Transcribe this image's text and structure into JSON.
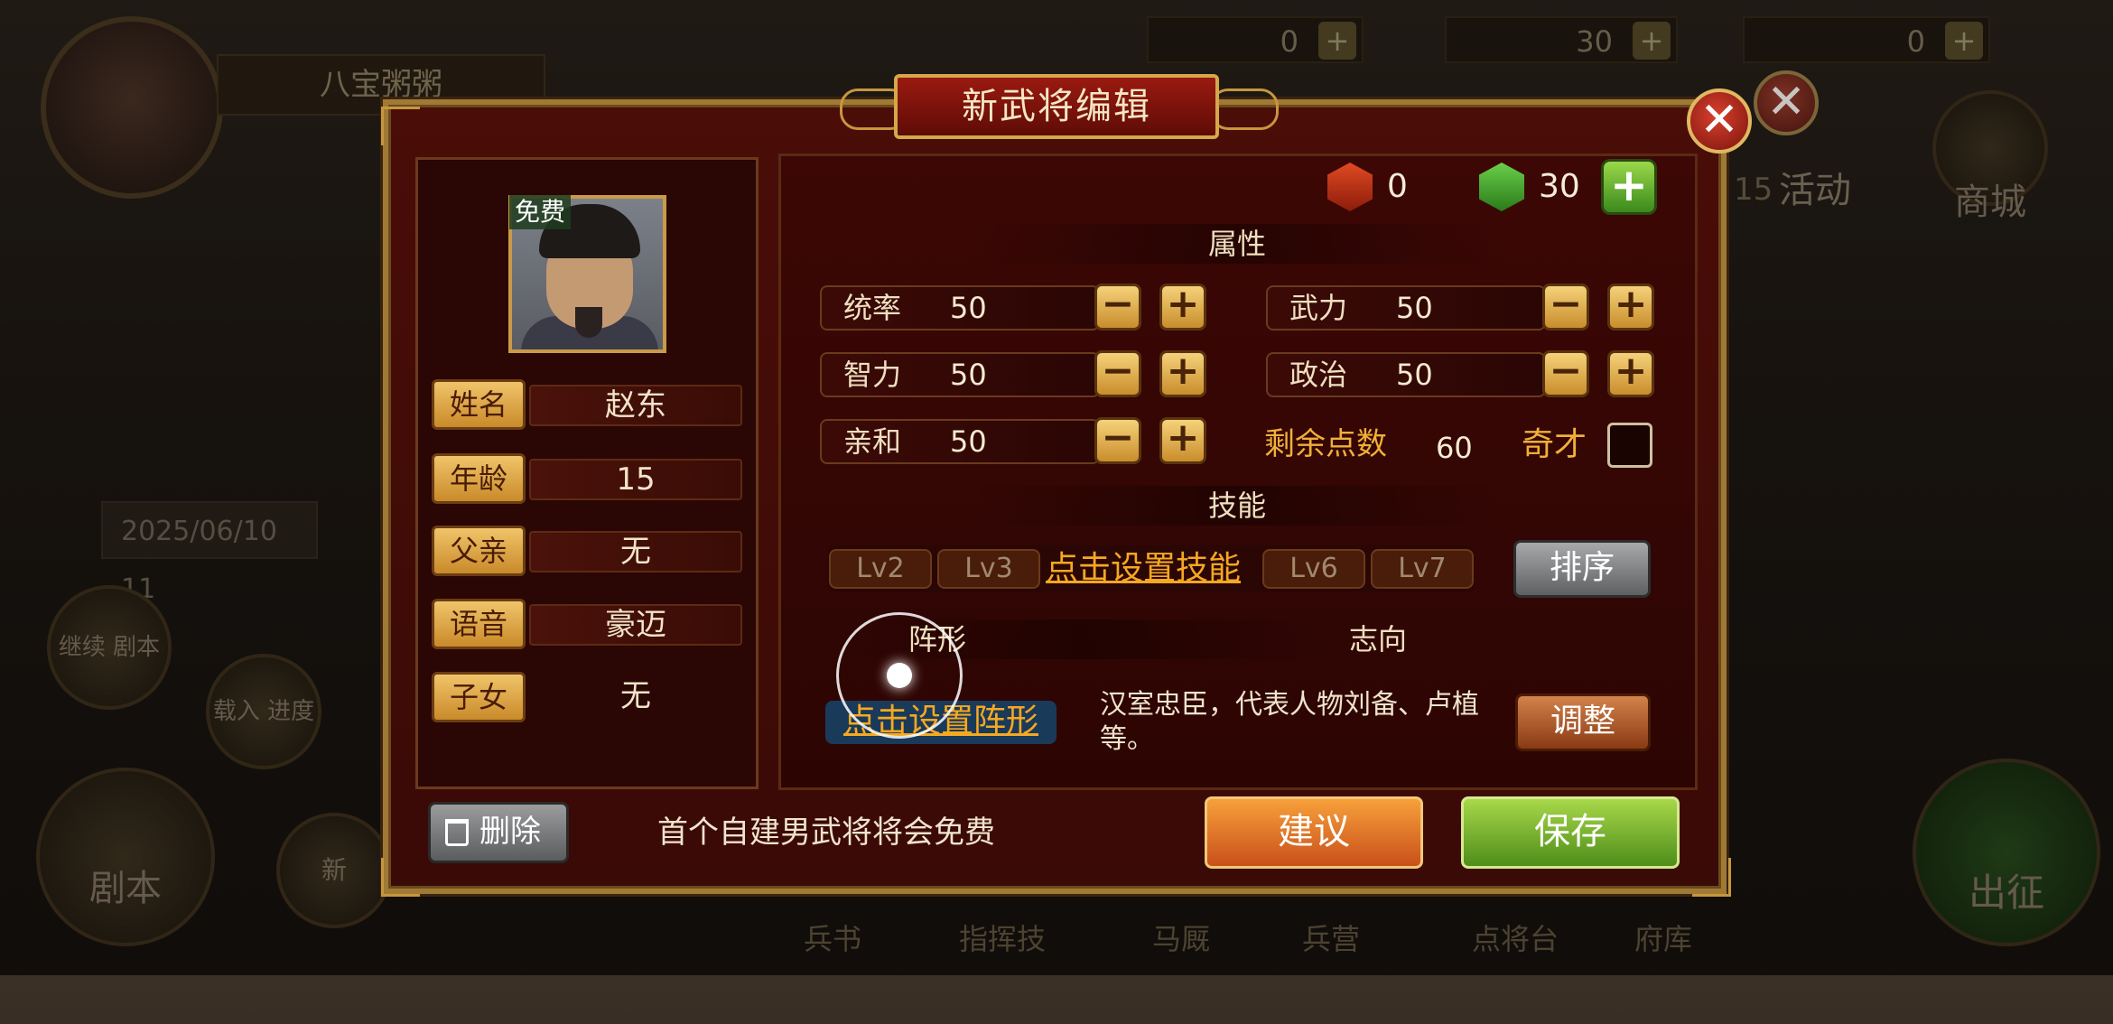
{
  "background": {
    "player_name": "八宝粥粥",
    "resources": [
      {
        "value": "0",
        "icon": "red-token-icon"
      },
      {
        "value": "30",
        "icon": "green-token-icon"
      },
      {
        "value": "0",
        "icon": "red-scroll-icon"
      }
    ],
    "date": "2025/06/10 11",
    "side_number": "15",
    "top_menu": [
      "活动",
      "商城"
    ],
    "left_menu": [
      "继续\n剧本",
      "载入\n进度",
      "剧本",
      "新"
    ],
    "bottom_menu": [
      "兵书",
      "指挥技",
      "马厩",
      "兵营",
      "点将台",
      "府库"
    ],
    "march_label": "出征"
  },
  "dialog": {
    "title": "新武将编辑",
    "portrait_badge": "免费",
    "profile": [
      {
        "label": "姓名",
        "value": "赵东"
      },
      {
        "label": "年龄",
        "value": "15"
      },
      {
        "label": "父亲",
        "value": "无"
      },
      {
        "label": "语音",
        "value": "豪迈"
      },
      {
        "label": "子女",
        "value": "无"
      }
    ],
    "currency": {
      "red": "0",
      "green": "30"
    },
    "attributes_title": "属性",
    "attributes": [
      {
        "name": "统率",
        "value": "50"
      },
      {
        "name": "武力",
        "value": "50"
      },
      {
        "name": "智力",
        "value": "50"
      },
      {
        "name": "政治",
        "value": "50"
      },
      {
        "name": "亲和",
        "value": "50"
      }
    ],
    "minus_label": "−",
    "plus_label": "+",
    "remaining_label": "剩余点数",
    "remaining_value": "60",
    "qicai_label": "奇才",
    "skills_title": "技能",
    "skill_levels": [
      "Lv2",
      "Lv3",
      "Lv6",
      "Lv7"
    ],
    "skill_set_label": "点击设置技能",
    "sort_label": "排序",
    "formation_title": "阵形",
    "formation_set_label": "点击设置阵形",
    "ambition_title": "志向",
    "ambition_text": "汉室忠臣，代表人物刘备、卢植等。",
    "adjust_label": "调整",
    "delete_label": "删除",
    "footnote": "首个自建男武将将会免费",
    "suggest_label": "建议",
    "save_label": "保存",
    "close_label": "✕"
  },
  "colors": {
    "accent_gold": "#c7963e",
    "panel_red": "#3a0a06",
    "orange_text": "#f6a820",
    "save_green": "#4e8e1a"
  }
}
